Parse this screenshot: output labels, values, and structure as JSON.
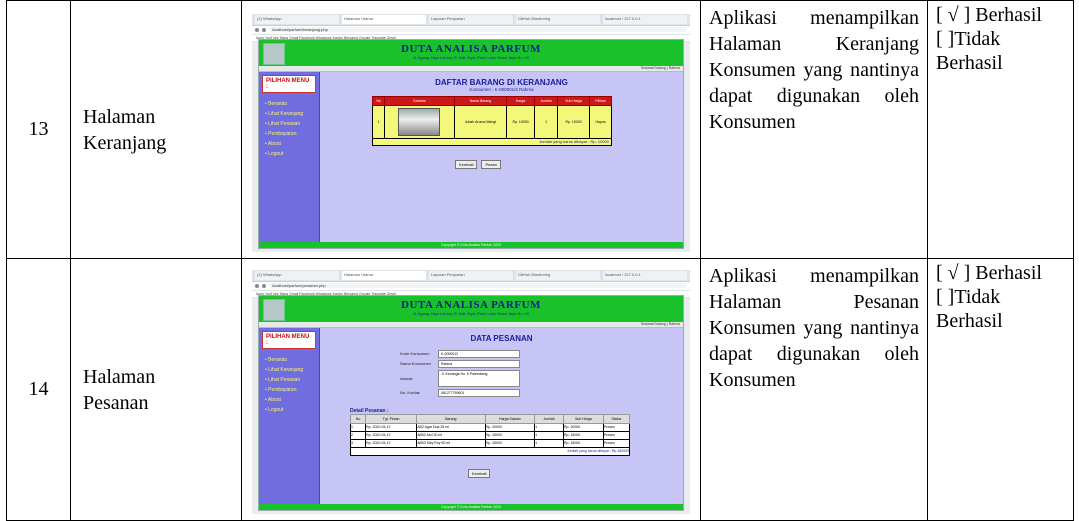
{
  "rows": [
    {
      "no": "13",
      "page_name": [
        "Halaman",
        "Keranjang"
      ],
      "description": "Aplikasi menampilkan Halaman Keranjang Konsumen yang nantinya dapat digunakan oleh Konsumen",
      "result_success": "[ √ ] Berhasil",
      "result_fail": "[ ]Tidak Berhasil",
      "screenshot": {
        "tabs": [
          "(2) WhatsApp",
          "Halaman Utama",
          "Laporan Penjualan",
          "GitHub Monitoring",
          "localhost / 127.0.0.1"
        ],
        "url": "localhost/parfum/keranjang.php",
        "bookmarks": "Apps  YouTube  Maps  Gmail  Facebook  WhatsApp  Kantor Bersama  Google Translate  Gmail",
        "site_title": "DUTA ANALISA PARFUM",
        "site_sub": "Jl. Agung Jaya Lorong Jl. Kali Jaya, Ruko Lake Nusa Jaya No. 19",
        "site_bar": "Selamat Datang | Rahma",
        "menu_head": "PILIHAN MENU :",
        "menu": [
          "Beranda",
          "Lihat Keranjang",
          "Lihat Pesanan",
          "Pembayaran",
          "About",
          "Logout"
        ],
        "main_title": "DAFTAR BARANG DI KERANJANG",
        "main_sub": "Konsumen : K-000001/2 Rahma",
        "cart_headers": [
          "No",
          "Gambar",
          "Nama Barang",
          "Harga",
          "Jumlah",
          "Sub Harga",
          "Pilihan"
        ],
        "cart_row": [
          "1",
          "",
          "Jubah Aroma Wangi",
          "Rp. 10000",
          "1",
          "Rp. 10000",
          "Hapus"
        ],
        "cart_total": "Jumlah yang harus dibayar : Rp. 10000",
        "buttons": [
          "Kembali",
          "Pesan"
        ],
        "footer": "Copyright © Duta Analisa Parfum 2020"
      }
    },
    {
      "no": "14",
      "page_name": [
        "Halaman",
        "Pesanan"
      ],
      "description": "Aplikasi menampilkan Halaman Pesanan Konsumen yang nantinya dapat digunakan oleh Konsumen",
      "result_success": "[ √ ] Berhasil",
      "result_fail": "[ ]Tidak Berhasil",
      "screenshot": {
        "tabs": [
          "(2) WhatsApp",
          "Halaman Utama",
          "Laporan Penjualan",
          "GitHub Monitoring",
          "localhost / 127.0.0.1"
        ],
        "url": "localhost/parfum/pesanan.php",
        "bookmarks": "Apps  YouTube  Maps  Gmail  Facebook  WhatsApp  Kantor Bersama  Google Translate  Gmail",
        "site_title": "DUTA ANALISA PARFUM",
        "site_sub": "Jl. Agung Jaya Lorong Jl. Kali Jaya, Ruko Lake Nusa Jaya No. 19",
        "site_bar": "Selamat Datang | Rahma",
        "menu_head": "PILIHAN MENU :",
        "menu": [
          "Beranda",
          "Lihat Keranjang",
          "Lihat Pesanan",
          "Pembayaran",
          "About",
          "Logout"
        ],
        "main_title": "DATA PESANAN",
        "form": [
          {
            "label": "Kode Konsumen",
            "value": "K-0000012"
          },
          {
            "label": "Nama Konsumen",
            "value": "Rahma"
          },
          {
            "label": "Alamat",
            "value": "Jl. Kenanga No. 5 Palembang"
          },
          {
            "label": "No. Kontak",
            "value": "081277789901"
          }
        ],
        "detail_caption": "Detail Pesanan :",
        "detail_headers": [
          "No",
          "Tgl. Pesan",
          "Barang",
          "Harga Satuan",
          "Jumlah",
          "Sub Harga",
          "Status"
        ],
        "detail_rows": [
          [
            "1",
            "Rp. 2020-03-12",
            "AB2 Agar Dua 25 ml",
            "Rp. 20000",
            "1",
            "Rp. 20000",
            "Proses"
          ],
          [
            "2",
            "Rp. 2020-03-12",
            "AB02 Asri 30 ml",
            "Rp. 15000",
            "1",
            "Rp. 15000",
            "Proses"
          ],
          [
            "3",
            "Rp. 2020-03-12",
            "AB03 Kiky Roy 50 ml",
            "Rp. 15000",
            "1",
            "Rp. 15000",
            "Proses"
          ]
        ],
        "detail_total": "Jumlah yang harus dibayar : Rp.160000",
        "button": "Kembali",
        "footer": "Copyright © Duta Analisa Parfum 2020"
      }
    }
  ]
}
